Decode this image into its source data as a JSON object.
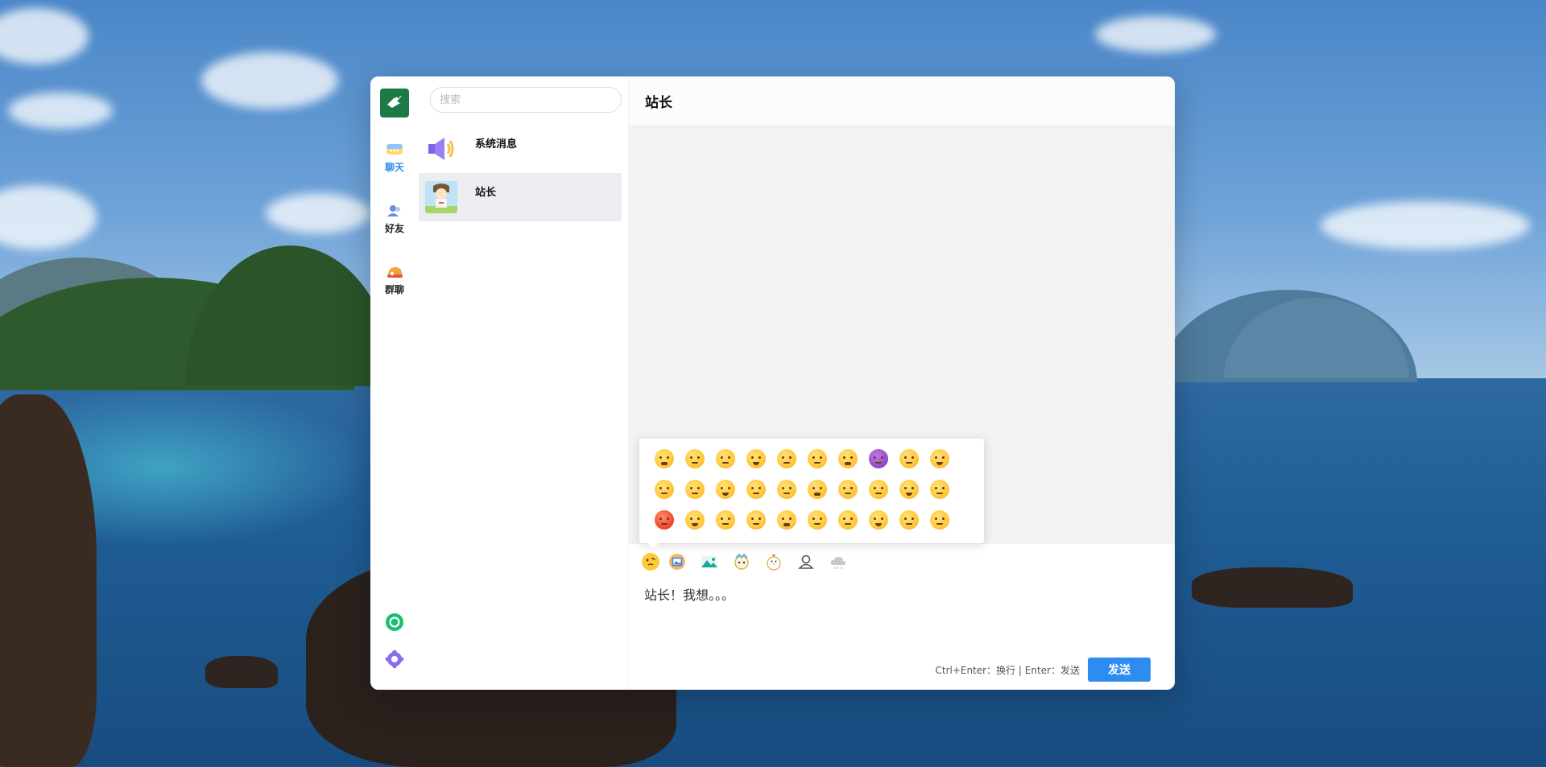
{
  "app": {
    "rail": {
      "logo_icon": "app-logo-bird",
      "items": [
        {
          "label": "聊天",
          "icon": "chat-bubbles-icon",
          "active": true
        },
        {
          "label": "好友",
          "icon": "friends-icon",
          "active": false
        },
        {
          "label": "群聊",
          "icon": "group-chat-icon",
          "active": false
        }
      ],
      "bottom": [
        {
          "icon": "green-circle-icon"
        },
        {
          "icon": "settings-gear-icon"
        }
      ]
    },
    "search": {
      "placeholder": "搜索",
      "value": ""
    },
    "conversations": [
      {
        "name": "系统消息",
        "avatar": "megaphone-avatar",
        "selected": false
      },
      {
        "name": "站长",
        "avatar": "character-avatar",
        "selected": true
      }
    ],
    "chat": {
      "title": "站长",
      "toolbar": [
        {
          "icon": "emoji-face-icon"
        },
        {
          "icon": "image-frame-icon"
        },
        {
          "icon": "picture-landscape-icon"
        },
        {
          "icon": "sticker-icon"
        },
        {
          "icon": "chicken-icon"
        },
        {
          "icon": "user-outline-icon"
        },
        {
          "icon": "cloud-icon"
        }
      ],
      "input_value": "站长！我想。。。",
      "hint": "Ctrl+Enter：换行 | Enter：发送",
      "send_label": "发送"
    },
    "emoji_panel": {
      "rows": [
        [
          "😞",
          "😅",
          "😃",
          "🤣",
          "😀",
          "😄",
          "😇",
          "😈",
          "😲",
          "😐"
        ],
        [
          "😑",
          "😏",
          "😔",
          "😌",
          "😒",
          "😣",
          "😶",
          "😘",
          "😊",
          "😋"
        ],
        [
          "😡",
          "😟",
          "😟",
          "😤",
          "😢",
          "😦",
          "😧",
          "😨",
          "😩",
          "😰"
        ]
      ]
    },
    "colors": {
      "accent": "#2d8cf0",
      "messages_bg": "#f2f2f2",
      "selected_row": "#ebedf0"
    }
  }
}
